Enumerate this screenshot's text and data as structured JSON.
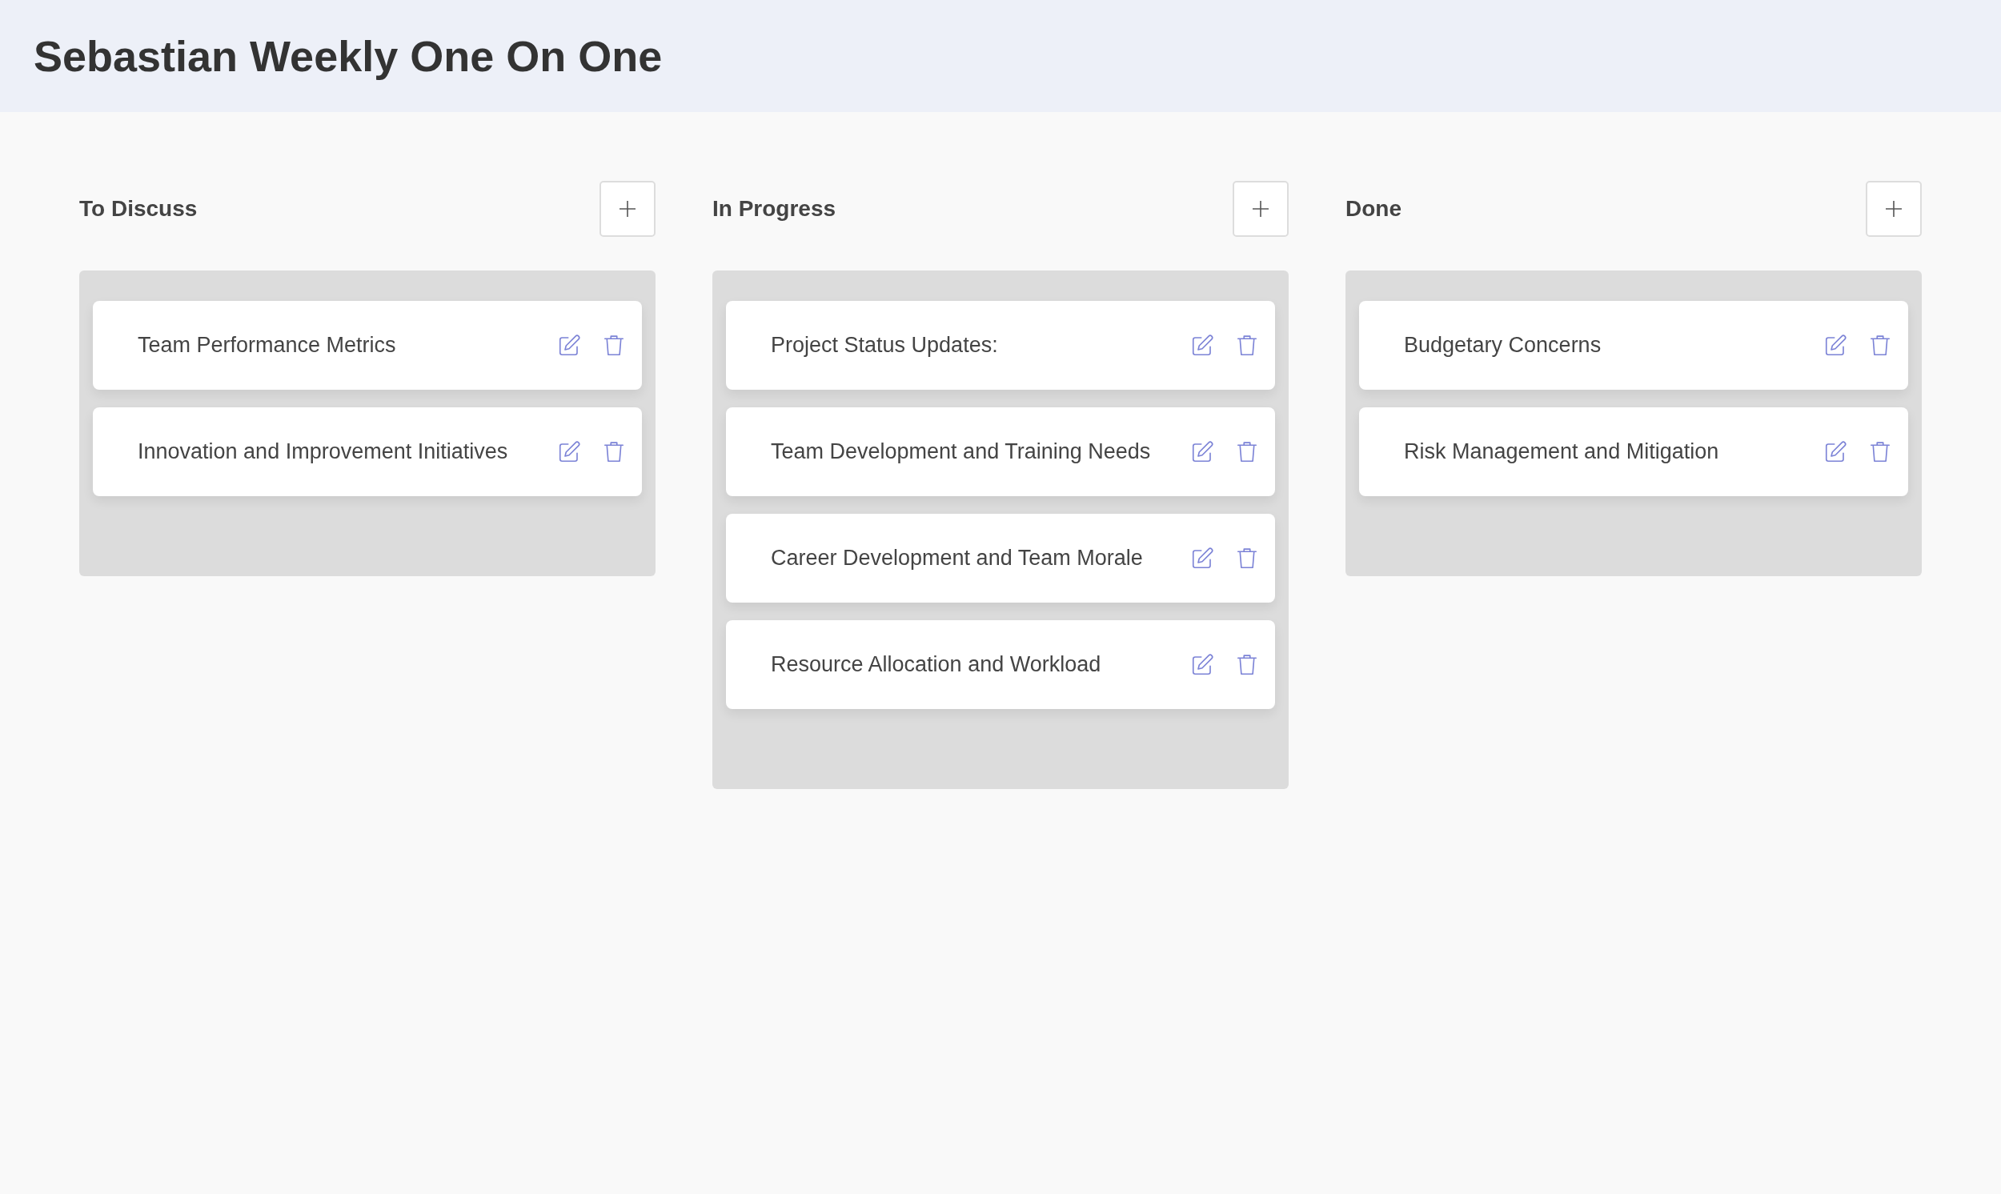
{
  "page": {
    "title": "Sebastian Weekly One On One"
  },
  "columns": [
    {
      "title": "To Discuss",
      "cards": [
        "Team Performance Metrics",
        "Innovation and Improvement Initiatives"
      ]
    },
    {
      "title": "In Progress",
      "cards": [
        "Project Status Updates:",
        "Team Development and Training Needs",
        "Career Development and Team Morale",
        "Resource Allocation and Workload"
      ]
    },
    {
      "title": "Done",
      "cards": [
        "Budgetary Concerns",
        "Risk Management and Mitigation"
      ]
    }
  ]
}
